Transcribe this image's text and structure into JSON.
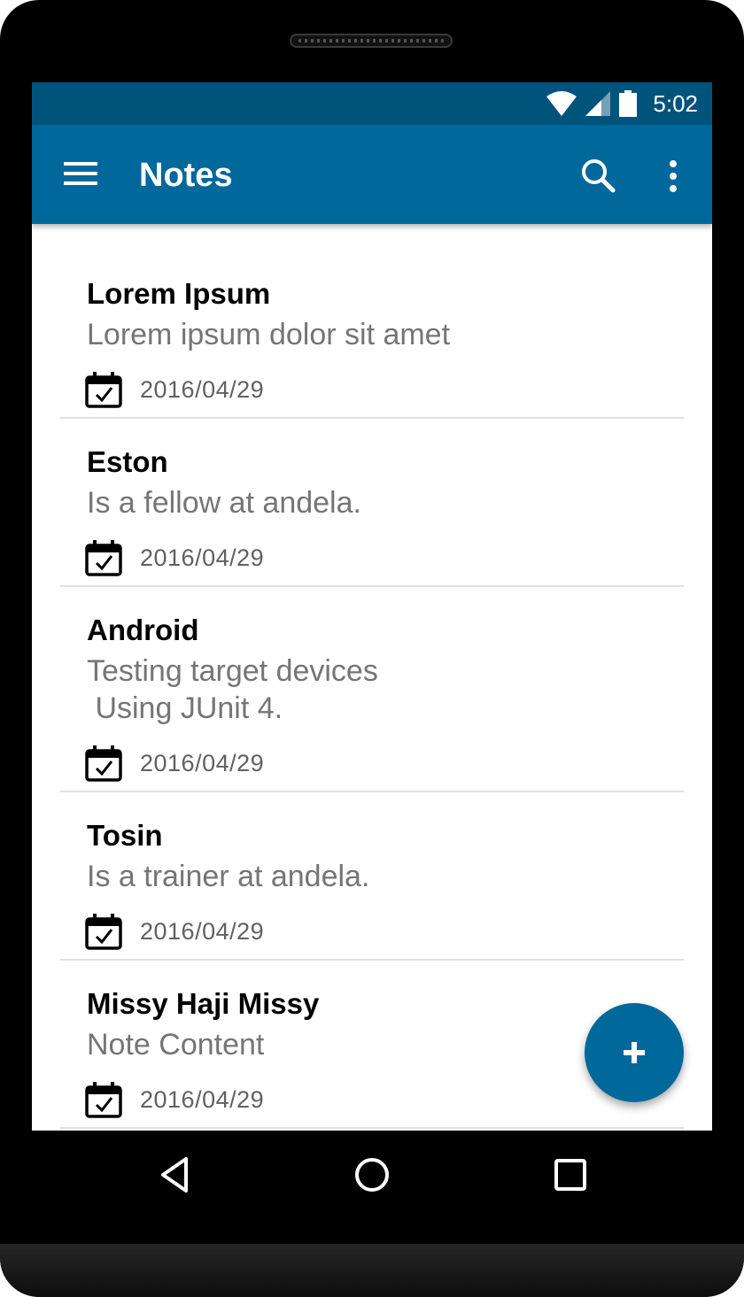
{
  "status_bar": {
    "time": "5:02",
    "icons": [
      "wifi-icon",
      "signal-icon",
      "battery-icon"
    ]
  },
  "app_bar": {
    "title": "Notes",
    "icons": [
      "menu-icon",
      "search-icon",
      "more-vert-icon"
    ]
  },
  "notes": [
    {
      "title": "Lorem Ipsum",
      "body": "Lorem ipsum dolor sit amet",
      "date": "2016/04/29"
    },
    {
      "title": "Eston",
      "body": "Is a fellow at andela.",
      "date": "2016/04/29"
    },
    {
      "title": "Android",
      "body": "Testing target devices\n Using JUnit 4.",
      "date": "2016/04/29"
    },
    {
      "title": "Tosin",
      "body": "Is a trainer at andela.",
      "date": "2016/04/29"
    },
    {
      "title": "Missy Haji Missy",
      "body": "Note Content",
      "date": "2016/04/29"
    }
  ],
  "fab": {
    "icon": "add-icon"
  },
  "nav_bar": {
    "icons": [
      "back-icon",
      "home-icon",
      "recents-icon"
    ]
  },
  "colors": {
    "status_bar": "#00547c",
    "app_bar": "#00689b",
    "accent": "#00689b",
    "title_text": "#000000",
    "body_text": "#757575"
  }
}
